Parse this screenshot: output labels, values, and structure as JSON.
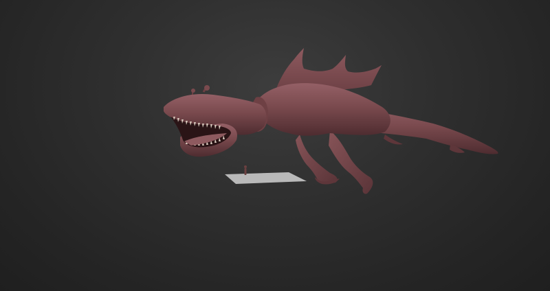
{
  "viewport": {
    "background_top": "#3d3d3d",
    "background_bottom": "#1f1f1f"
  },
  "model": {
    "icon": "creature-model-icon",
    "color": "#7a4a4e",
    "shadow_color": "#4e2c30",
    "highlight_color": "#9a6468",
    "mouth_color": "#2a1416",
    "teeth_color": "#d8c9bd"
  },
  "ground_plane": {
    "icon": "ground-plane-icon",
    "color": "#b8b8b8"
  },
  "scale_figure": {
    "icon": "human-scale-reference-icon",
    "color": "#6b4040"
  }
}
